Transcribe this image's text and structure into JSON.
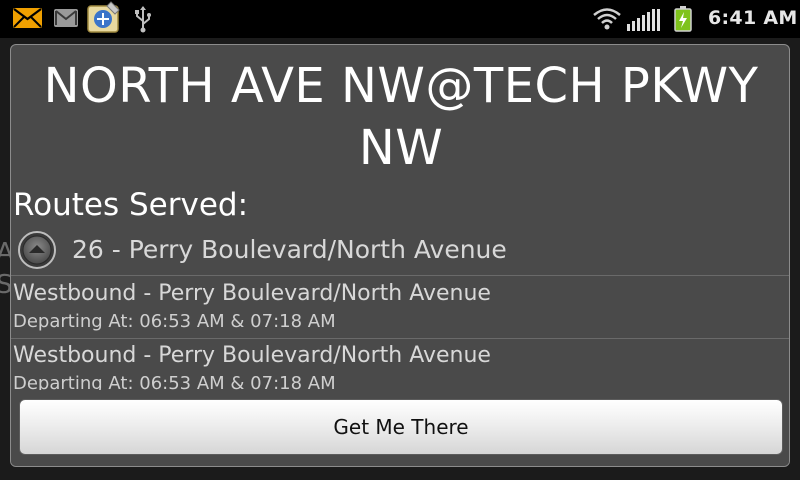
{
  "status_bar": {
    "time": "6:41 AM",
    "icons": [
      "mail-icon",
      "gmail-icon",
      "app-notification-icon",
      "usb-icon",
      "wifi-icon",
      "signal-icon",
      "battery-charging-icon"
    ]
  },
  "dialog": {
    "title": "NORTH AVE NW@TECH PKWY NW",
    "routes_heading": "Routes Served:",
    "route": {
      "label": "26 - Perry Boulevard/North Avenue",
      "expander_icon": "collapse-arrow-icon"
    },
    "trips": [
      {
        "direction": "Westbound - Perry Boulevard/North Avenue",
        "departing": "Departing At: 06:53 AM & 07:18 AM"
      },
      {
        "direction": "Westbound - Perry Boulevard/North Avenue",
        "departing": "Departing At: 06:53 AM & 07:18 AM"
      }
    ],
    "button_label": "Get Me There"
  },
  "colors": {
    "dialog_bg": "#4a4a4a",
    "status_bg": "#000000",
    "battery_green": "#7fc31c",
    "mail_orange": "#f0a000"
  }
}
